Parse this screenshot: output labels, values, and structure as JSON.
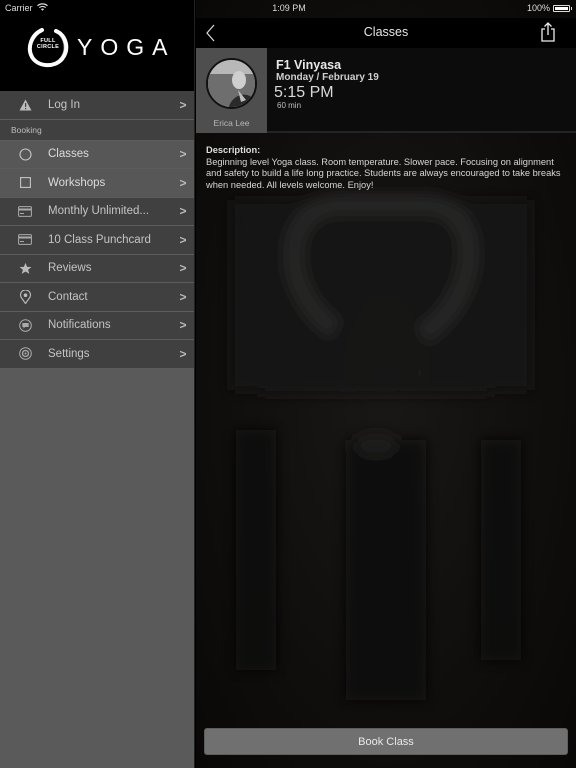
{
  "status_bar": {
    "carrier": "Carrier",
    "time": "1:09 PM",
    "battery": "100%"
  },
  "sidebar": {
    "logo": {
      "inner_line1": "FULL",
      "inner_line2": "CIRCLE",
      "word": "YOGA"
    },
    "login": {
      "label": "Log In",
      "icon": "warning-icon"
    },
    "section_label": "Booking",
    "items": [
      {
        "label": "Classes",
        "icon": "circle-icon",
        "selected": true
      },
      {
        "label": "Workshops",
        "icon": "square-icon",
        "selected": true
      },
      {
        "label": "Monthly Unlimited...",
        "icon": "credit-card-icon",
        "selected": false
      },
      {
        "label": "10 Class Punchcard",
        "icon": "credit-card-icon",
        "selected": false
      },
      {
        "label": "Reviews",
        "icon": "star-icon",
        "selected": false
      },
      {
        "label": "Contact",
        "icon": "location-pin-icon",
        "selected": false
      },
      {
        "label": "Notifications",
        "icon": "chat-bubble-icon",
        "selected": false
      },
      {
        "label": "Settings",
        "icon": "settings-icon",
        "selected": false
      }
    ],
    "chevron": ">"
  },
  "navbar": {
    "title": "Classes",
    "back_icon": "back-chevron-icon",
    "share_icon": "share-icon"
  },
  "class_detail": {
    "instructor": "Erica Lee",
    "name": "F1 Vinyasa",
    "date": "Monday / February 19",
    "time": "5:15 PM",
    "duration": "60 min",
    "description_label": "Description:",
    "description": "Beginning level Yoga class. Room temperature. Slower pace. Focusing on alignment and safety to build a life long practice. Students are always encouraged to take breaks when needed. All levels welcome. Enjoy!"
  },
  "book_button": "Book Class",
  "colors": {
    "sidebar_bg": "#5a5a5a",
    "menu_bg": "#404040",
    "menu_selected_bg": "#575757",
    "button_bg": "#707070",
    "header_bg": "#000000"
  }
}
